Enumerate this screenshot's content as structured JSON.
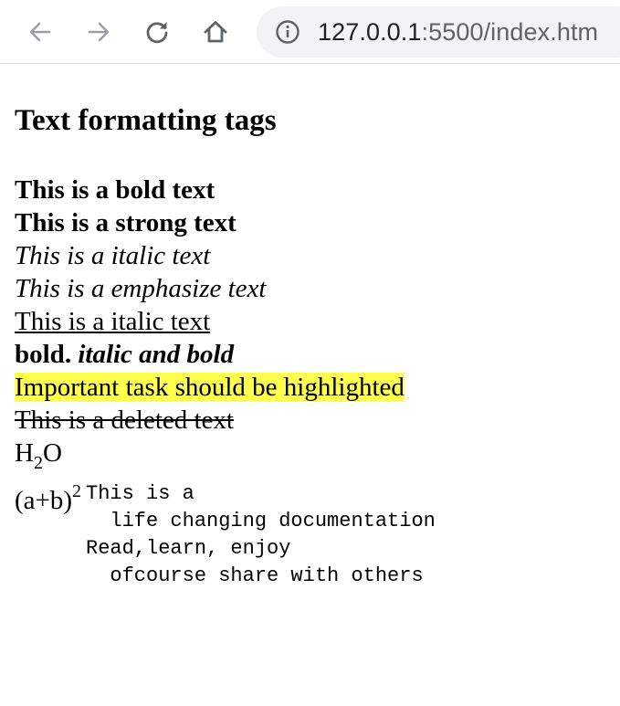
{
  "browser": {
    "url_host": "127.0.0.1",
    "url_rest": ":5500/index.htm",
    "icons": {
      "back": "arrow-left-icon",
      "forward": "arrow-right-icon",
      "reload": "reload-icon",
      "home": "home-icon",
      "site_info": "info-icon"
    }
  },
  "page": {
    "heading": "Text formatting tags",
    "bold": "This is a bold text",
    "strong": "This is a strong text",
    "italic": "This is a italic text",
    "emphasize": "This is a emphasize text",
    "underline": "This is a italic text",
    "bold_part": "bold.",
    "italic_bold_part": "italic and bold",
    "highlight": "Important task should be highlighted",
    "deleted": "This is a deleted text",
    "h2o_h": "H",
    "h2o_sub": "2",
    "h2o_o": "O",
    "formula_base": "(a+b)",
    "formula_sup": "2",
    "pre_lines": [
      "This is a",
      "  life changing documentation",
      "Read,learn, enjoy",
      "  ofcourse share with others"
    ]
  },
  "colors": {
    "highlight": "#ffff4d",
    "omnibox_bg": "#f1f3f4",
    "icon": "#5f6368"
  }
}
